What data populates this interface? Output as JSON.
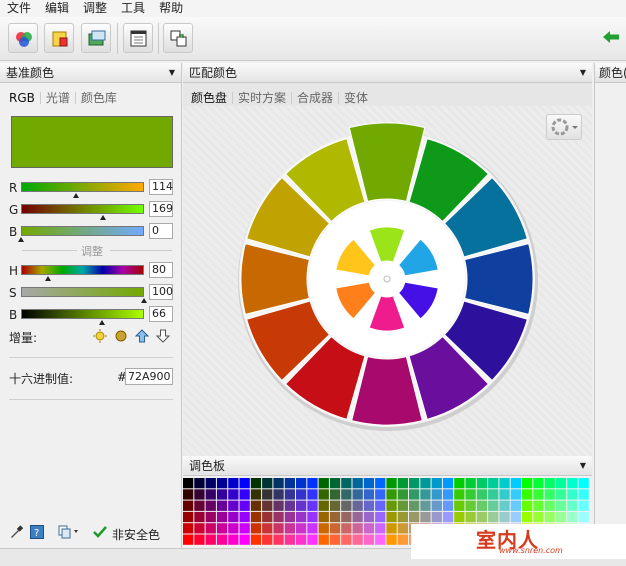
{
  "menu": [
    "文件",
    "编辑",
    "调整",
    "工具",
    "帮助"
  ],
  "toolbar": {
    "buttons": [
      "color-scheme-icon",
      "image-palette-icon",
      "screenshot-icon",
      "swatch-library-icon",
      "copy-swap-icon"
    ],
    "back_icon": "back-arrow-icon"
  },
  "left_panel": {
    "title": "基准颜色",
    "tabs": [
      "RGB",
      "光谱",
      "颜色库"
    ],
    "current_color": "#72A900",
    "rgb": {
      "r": 114,
      "g": 169,
      "b": 0
    },
    "adjust_label": "调整",
    "hsb": {
      "h": 80,
      "s": 100,
      "b": 66
    },
    "increment_label": "增量:",
    "hex_label": "十六进制值:",
    "hex_hash": "#",
    "hex_value": "72A900",
    "websafe_label": "非安全色"
  },
  "match_panel": {
    "title": "匹配颜色",
    "tabs": [
      "颜色盘",
      "实时方案",
      "合成器",
      "变体"
    ]
  },
  "swatches_panel": {
    "title": "调色板"
  },
  "right_panel": {
    "title": "颜色("
  },
  "watermark": {
    "main": "室内人",
    "sub": "www.snren.com"
  },
  "colors": {
    "wheel": [
      "#72A900",
      "#0E9A18",
      "#06719C",
      "#0F40A0",
      "#2D119C",
      "#6A0E9E",
      "#A8096C",
      "#C50E16",
      "#C73A05",
      "#C76900",
      "#C0A300",
      "#B0B800"
    ],
    "selected": "#72A900"
  }
}
